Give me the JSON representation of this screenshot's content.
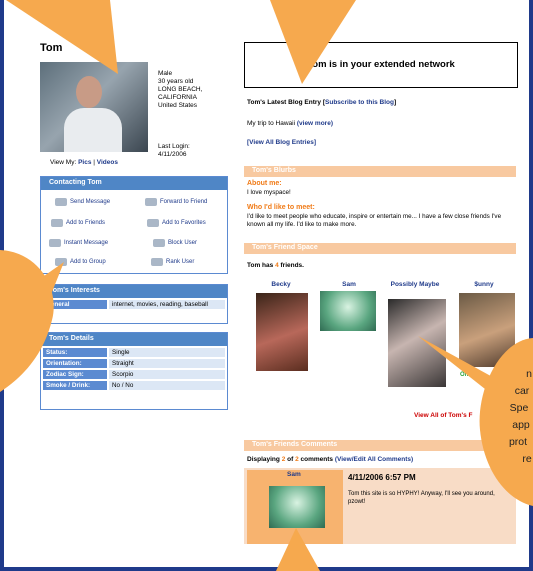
{
  "profile": {
    "name": "Tom",
    "info": [
      "Male",
      "30 years old",
      "LONG BEACH,",
      "CALIFORNIA",
      "United States"
    ],
    "last_login_label": "Last Login:",
    "last_login_date": "4/11/2006",
    "view_my": "View My:",
    "pics": "Pics",
    "sep": "|",
    "videos": "Videos"
  },
  "contacting": {
    "title": "Contacting Tom",
    "send_message": "Send Message",
    "forward": "Forward to Friend",
    "add_friends": "Add to Friends",
    "add_favorites": "Add to Favorites",
    "instant_message": "Instant Message",
    "block_user": "Block User",
    "add_group": "Add to Group",
    "rank_user": "Rank User"
  },
  "interests": {
    "title": "Tom's Interests",
    "label": "General",
    "value": "internet, movies, reading, baseball"
  },
  "details": {
    "title": "Tom's Details",
    "rows": [
      {
        "k": "Status:",
        "v": "Single"
      },
      {
        "k": "Orientation:",
        "v": "Straight"
      },
      {
        "k": "Zodiac Sign:",
        "v": "Scorpio"
      },
      {
        "k": "Smoke / Drink:",
        "v": "No / No"
      }
    ]
  },
  "network_banner": "Tom is in your extended network",
  "blog": {
    "title": "Tom's Latest Blog Entry",
    "bracket_open": "[",
    "subscribe": "Subscribe to this Blog",
    "bracket_close": "]",
    "entry": "My trip to Hawaii",
    "view_more": "(view more)",
    "view_all": "[View All Blog Entries]"
  },
  "blurbs": {
    "title": "Tom's Blurbs",
    "about_h": "About me:",
    "about_t": "I love myspace!",
    "who_h": "Who I'd like to meet:",
    "who_t": "I'd like to meet people who educate, inspire or entertain me... I have a few close friends I've known all my life. I'd like to make more."
  },
  "friend_space": {
    "title": "Tom's Friend Space",
    "count_prefix": "Tom has",
    "count": "4",
    "count_suffix": "friends.",
    "friends": [
      "Becky",
      "Sam",
      "Possibly Maybe",
      "$unny"
    ],
    "online": "Online",
    "view_all": "View All of Tom's F"
  },
  "comments": {
    "title": "Tom's Friends Comments",
    "displaying": "Displaying",
    "shown": "2",
    "of": "of",
    "total": "2",
    "comments_word": "comments",
    "view_edit": "(View/Edit All Comments)",
    "author": "Sam",
    "date": "4/11/2006 6:57 PM",
    "text": "Tom this site is so HYPHY! Anyway, I'll see you around, pzowt!"
  },
  "callout": {
    "lines": [
      "n",
      "car",
      "Spe",
      "app",
      "prot",
      "re"
    ]
  },
  "colors": {
    "brand_blue": "#1f3a8a",
    "header_blue": "#4f86c6",
    "accent_orange": "#f07a16",
    "callout": "#f6a94e"
  }
}
